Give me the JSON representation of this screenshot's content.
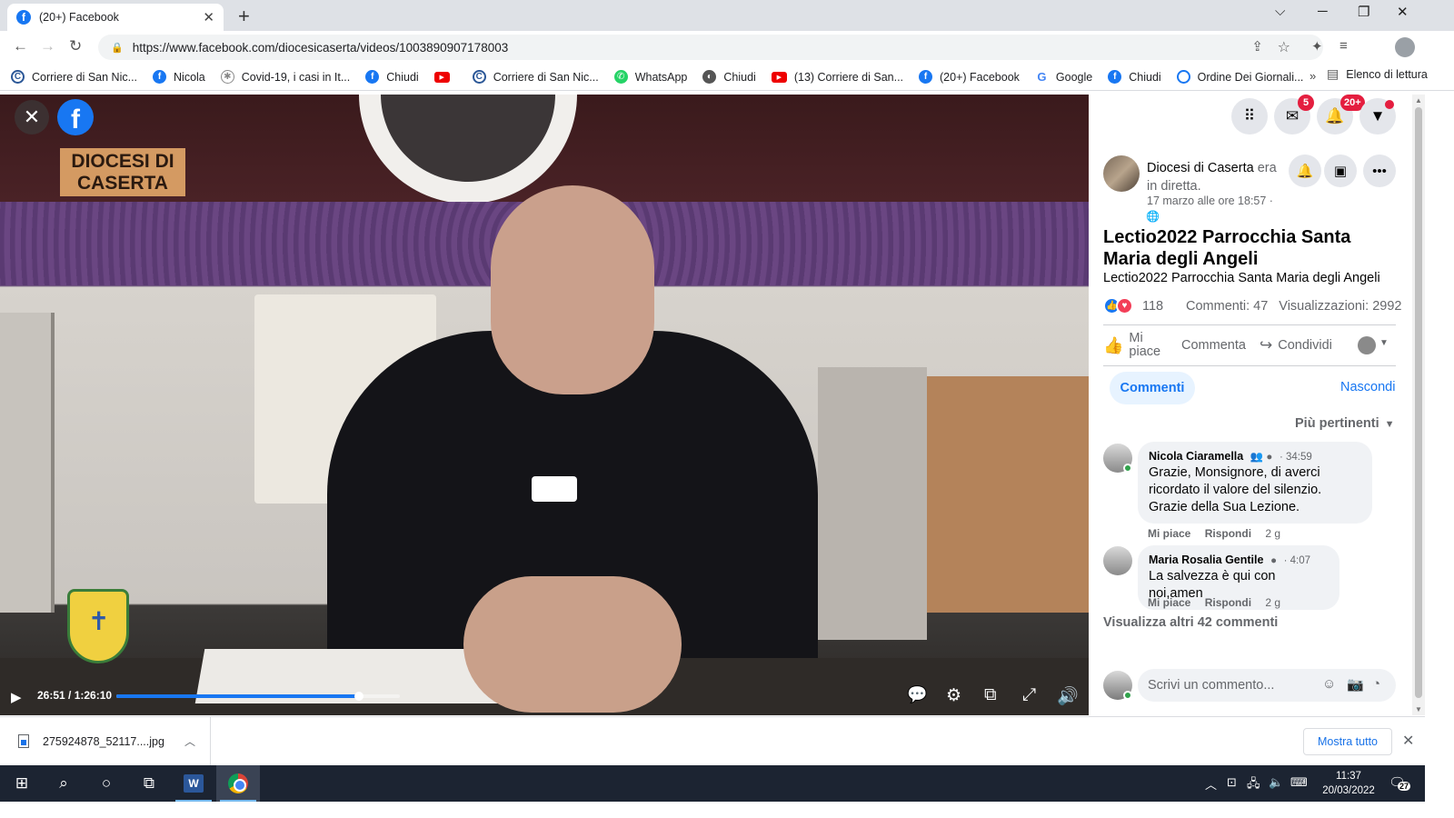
{
  "browser": {
    "tab_title": "(20+) Facebook",
    "tab_icon": "f",
    "url": "https://www.facebook.com/diocesicaserta/videos/1003890907178003",
    "bookmarks": [
      {
        "label": "Corriere di San Nic...",
        "icon": "newspaper-icon",
        "kind": "cs"
      },
      {
        "label": "Nicola",
        "icon": "facebook-icon",
        "kind": "fb"
      },
      {
        "label": "Covid-19, i casi in It...",
        "icon": "covid-icon",
        "kind": "cv"
      },
      {
        "label": "Chiudi",
        "icon": "facebook-icon",
        "kind": "fb"
      },
      {
        "label": "",
        "icon": "youtube-icon",
        "kind": "yt"
      },
      {
        "label": "Corriere di San Nic...",
        "icon": "newspaper-icon",
        "kind": "cs"
      },
      {
        "label": "WhatsApp",
        "icon": "whatsapp-icon",
        "kind": "wa"
      },
      {
        "label": "Chiudi",
        "icon": "globe-icon",
        "kind": "ch"
      },
      {
        "label": "(13) Corriere di San...",
        "icon": "youtube-icon",
        "kind": "yt"
      },
      {
        "label": "(20+) Facebook",
        "icon": "facebook-icon",
        "kind": "fb"
      },
      {
        "label": "Google",
        "icon": "google-icon",
        "kind": "gg"
      },
      {
        "label": "Chiudi",
        "icon": "facebook-icon",
        "kind": "fb"
      },
      {
        "label": "Ordine Dei Giornali...",
        "icon": "ordine-icon",
        "kind": "od"
      }
    ],
    "more_bookmarks": "»",
    "reading_list": "Elenco di lettura"
  },
  "video": {
    "brand_text": "DIOCESI DI CASERTA",
    "current_time": "26:51",
    "duration": "1:26:10",
    "time_display": "26:51 / 1:26:10",
    "progress_fraction": 0.311,
    "buffered_fraction": 0.86,
    "fb_logo": "f"
  },
  "header": {
    "messenger_badge": "5",
    "notifications_badge": "20+"
  },
  "post": {
    "author": "Diocesi di Caserta",
    "author_suffix": " era in diretta.",
    "date": "17 marzo alle ore 18:57 ·",
    "title": "Lectio2022 Parrocchia Santa Maria degli Angeli",
    "description": "Lectio2022 Parrocchia Santa Maria degli Angeli",
    "reactions_count": "118",
    "comments_stat": "Commenti: 47",
    "views_stat": "Visualizzazioni: 2992",
    "like_label": "Mi piace",
    "comment_label": "Commenta",
    "share_label": "Condividi"
  },
  "comments": {
    "tab_label": "Commenti",
    "hide_label": "Nascondi",
    "sort_label": "Più pertinenti",
    "items": [
      {
        "name": "Nicola Ciaramella",
        "time": "· 34:59",
        "text": "Grazie, Monsignore, di averci ricordato il valore del silenzio. Grazie della Sua Lezione.",
        "like": "Mi piace",
        "reply": "Rispondi",
        "age": "2 g"
      },
      {
        "name": "Maria Rosalia Gentile",
        "time": "· 4:07",
        "text": "La salvezza è qui con noi,amen",
        "like": "Mi piace",
        "reply": "Rispondi",
        "age": "2 g"
      }
    ],
    "more_label": "Visualizza altri 42 commenti",
    "write_placeholder": "Scrivi un commento..."
  },
  "downloads": {
    "file_name": "275924878_52117....jpg",
    "show_all": "Mostra tutto"
  },
  "taskbar": {
    "time": "11:37",
    "date": "20/03/2022",
    "notification_count": "27",
    "word_letter": "W"
  },
  "colors": {
    "facebook_blue": "#1877f2",
    "badge_red": "#e41e3f",
    "taskbar": "#1c2432"
  }
}
